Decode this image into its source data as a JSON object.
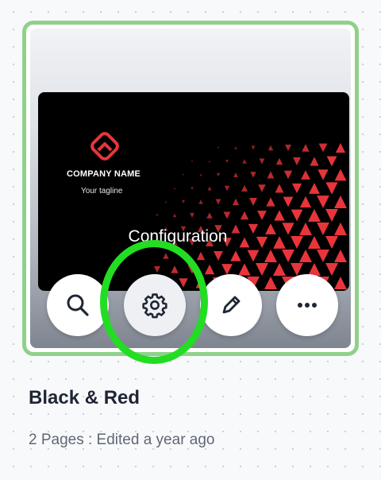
{
  "template": {
    "title": "Black & Red",
    "meta": "2 Pages : Edited a year ago",
    "preview": {
      "company_name": "COMPANY NAME",
      "tagline": "Your tagline",
      "overlay_label": "Configuration"
    }
  },
  "actions": [
    {
      "name": "search",
      "icon": "search-icon"
    },
    {
      "name": "configure",
      "icon": "gear-icon"
    },
    {
      "name": "edit",
      "icon": "pencil-icon"
    },
    {
      "name": "more",
      "icon": "more-horizontal-icon"
    }
  ],
  "colors": {
    "selection_border": "#8fd18b",
    "highlight_ring": "#22dd22",
    "brand_red": "#e8353b",
    "text_dark": "#1f2633",
    "text_muted": "#5f6775"
  }
}
